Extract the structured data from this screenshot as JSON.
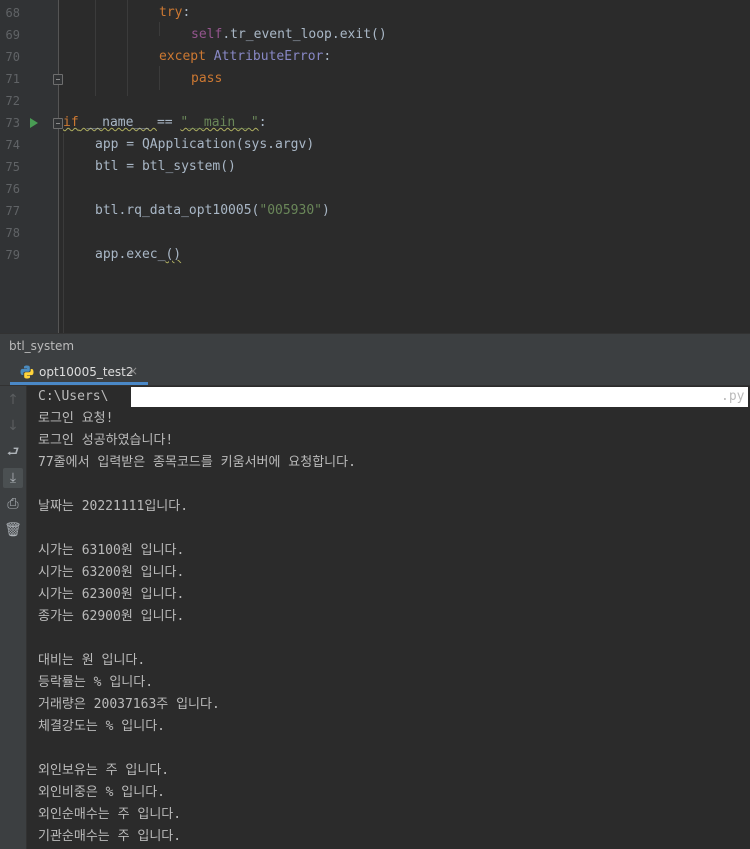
{
  "editor": {
    "lines": [
      {
        "n": "68"
      },
      {
        "n": "69"
      },
      {
        "n": "70"
      },
      {
        "n": "71"
      },
      {
        "n": "72"
      },
      {
        "n": "73"
      },
      {
        "n": "74"
      },
      {
        "n": "75"
      },
      {
        "n": "76"
      },
      {
        "n": "77"
      },
      {
        "n": "78"
      },
      {
        "n": "79"
      }
    ],
    "code": {
      "l68_kw": "try",
      "l68_punct": ":",
      "l69_self": "self",
      "l69_rest": ".tr_event_loop.exit()",
      "l70_kw": "except",
      "l70_cls": "AttributeError",
      "l70_punct": ":",
      "l71_kw": "pass",
      "l73_kw": "if",
      "l73_name": " __name__ ",
      "l73_op": "== ",
      "l73_str": "\"__main__\"",
      "l73_punct": ":",
      "l74": "app = QApplication(sys.argv)",
      "l75": "btl = btl_system()",
      "l77_call": "btl.rq_data_opt10005(",
      "l77_str": "\"005930\"",
      "l77_close": ")",
      "l79_call": "app.exec_",
      "l79_parens": "()"
    }
  },
  "tool_window": {
    "title": "btl_system",
    "tab_label": "opt10005_test2",
    "tab_close": "×"
  },
  "toolbar_icons": [
    "arrow-up-icon",
    "arrow-down-icon",
    "soft-wrap-icon",
    "scroll-to-end-icon",
    "print-icon",
    "trash-icon"
  ],
  "console": {
    "path_prefix": "C:\\Users\\",
    "path_suffix": ".py",
    "lines": [
      "로그인 요청!",
      "로그인 성공하였습니다!",
      "77줄에서 입력받은 종목코드를 키움서버에 요청합니다.",
      "",
      "날짜는 20221111입니다.",
      "",
      "시가는 63100원 입니다.",
      "시가는 63200원 입니다.",
      "시가는 62300원 입니다.",
      "종가는 62900원 입니다.",
      "",
      "대비는 원 입니다.",
      "등락률는 % 입니다.",
      "거래량은 20037163주 입니다.",
      "체결강도는 % 입니다.",
      "",
      "외인보유는 주 입니다.",
      "외인비중은 % 입니다.",
      "외인순매수는 주 입니다.",
      "기관순매수는 주 입니다."
    ]
  },
  "colors": {
    "keyword": "#cc7832",
    "self": "#94558d",
    "builtin_class": "#8888c6",
    "string": "#6a8759",
    "run_green": "#499c54",
    "tab_accent": "#4a88c7"
  }
}
